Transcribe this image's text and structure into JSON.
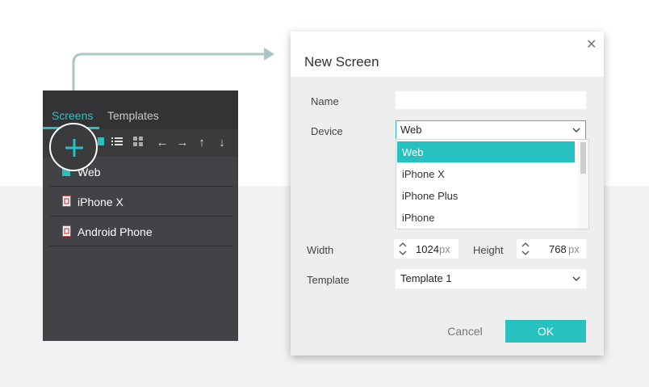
{
  "panel": {
    "tabs": [
      {
        "label": "Screens",
        "active": true
      },
      {
        "label": "Templates",
        "active": false
      }
    ],
    "toolbar_icons": [
      "add-icon",
      "screen-icon",
      "list-view-icon",
      "grid-view-icon",
      "arrow-left-icon",
      "arrow-right-icon",
      "arrow-up-icon",
      "arrow-down-icon"
    ],
    "screens": [
      {
        "label": "Web",
        "icon": "web-screen-icon"
      },
      {
        "label": "iPhone X",
        "icon": "mobile-screen-icon"
      },
      {
        "label": "Android Phone",
        "icon": "mobile-screen-icon"
      }
    ]
  },
  "dialog": {
    "title": "New Screen",
    "name_label": "Name",
    "name_value": "",
    "device_label": "Device",
    "device_value": "Web",
    "device_options": [
      "Web",
      "iPhone X",
      "iPhone Plus",
      "iPhone"
    ],
    "width_label": "Width",
    "width_value": "1024",
    "height_label": "Height",
    "height_value": "768",
    "unit": "px",
    "template_label": "Template",
    "template_value": "Template 1",
    "cancel_label": "Cancel",
    "ok_label": "OK"
  },
  "colors": {
    "accent": "#26c1c0",
    "panel_bg": "#434347",
    "panel_header": "#333336",
    "dialog_bg": "#eeeeee"
  }
}
